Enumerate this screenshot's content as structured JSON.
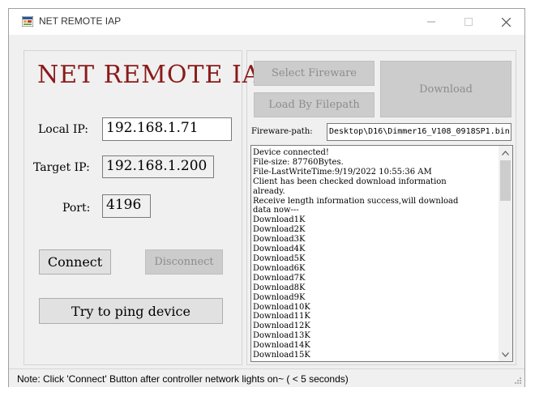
{
  "window": {
    "title": "NET REMOTE IAP"
  },
  "left": {
    "heading": "NET REMOTE IAP",
    "local_ip_label": "Local IP:",
    "local_ip_value": "192.168.1.71",
    "target_ip_label": "Target IP:",
    "target_ip_value": "192.168.1.200",
    "port_label": "Port:",
    "port_value": "4196",
    "connect_label": "Connect",
    "disconnect_label": "Disconnect",
    "ping_label": "Try to ping device"
  },
  "right": {
    "select_firmware_label": "Select Fireware",
    "load_by_filepath_label": "Load By Filepath",
    "download_label": "Download",
    "firmware_path_label": "Fireware-path:",
    "firmware_path_value": "Desktop\\D16\\Dimmer16_V108_0918SP1.bin",
    "log_lines": [
      "Device connected!",
      "File-size: 87760Bytes.",
      "File-LastWriteTime:9/19/2022 10:55:36 AM",
      "Client has been checked download information",
      "already.",
      "Receive length information success,will download",
      "data now---",
      "Download1K",
      "Download2K",
      "Download3K",
      "Download4K",
      "Download5K",
      "Download6K",
      "Download7K",
      "Download8K",
      "Download9K",
      "Download10K",
      "Download11K",
      "Download12K",
      "Download13K",
      "Download14K",
      "Download15K"
    ]
  },
  "status": {
    "note": "Note: Click 'Connect' Button after controller network lights on~ ( < 5 seconds)"
  },
  "colors": {
    "title_accent": "#8b1a1a",
    "window_bg": "#f0f0f0",
    "disabled_button_bg": "#cccccc"
  }
}
